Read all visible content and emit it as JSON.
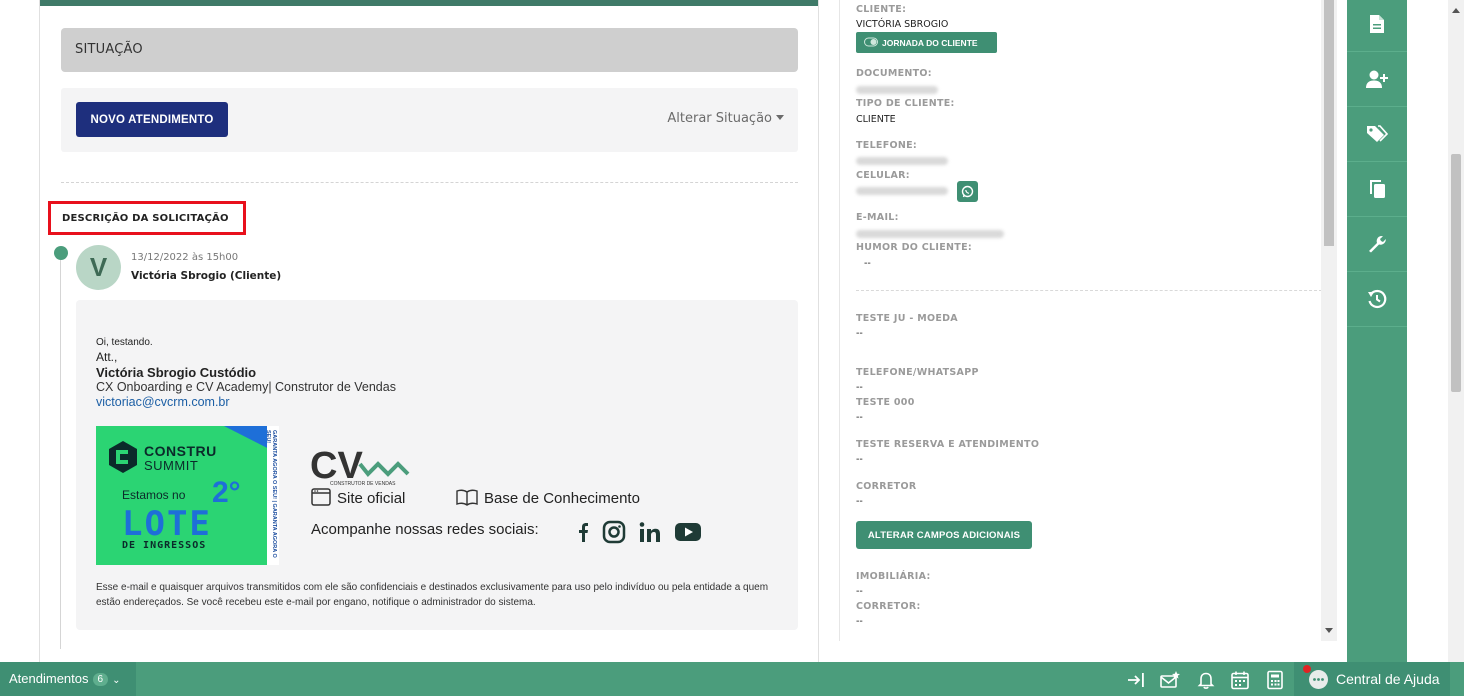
{
  "colors": {
    "accent": "#4b9d7c",
    "accent_dark": "#3f8f73",
    "primary_button": "#1e2f7d",
    "highlight_box": "#e8101c",
    "link": "#1c5fa5"
  },
  "main": {
    "situacao_label": "SITUAÇÃO",
    "novo_atendimento_label": "NOVO ATENDIMENTO",
    "alterar_situacao_label": "Alterar Situação",
    "descricao_label": "DESCRIÇÃO DA SOLICITAÇÃO",
    "message": {
      "avatar_letter": "V",
      "date": "13/12/2022 às 15h00",
      "author": "Victória Sbrogio (Cliente)"
    },
    "email": {
      "greeting": "Oi, testando.",
      "att": "Att.,",
      "sig_name": "Victória Sbrogio Custódio",
      "sig_role": "CX Onboarding e CV Academy| Construtor de Vendas",
      "sig_email": "victoriac@cvcrm.com.br",
      "banner": {
        "line1": "CONSTRU",
        "line2": "SUMMIT",
        "estamos": "Estamos no",
        "number": "2°",
        "lote": "LOTE",
        "ingressos": "DE INGRESSOS",
        "side": "GARANTA AGORA O SEU! | GARANTA AGORA O SEU!"
      },
      "cv_logo_text": "CV",
      "cv_sub": "CONSTRUTOR DE VENDAS",
      "site_label": "Site oficial",
      "base_label": "Base de Conhecimento",
      "social_label": "Acompanhe nossas redes sociais:",
      "social_icons": [
        "facebook-icon",
        "instagram-icon",
        "linkedin-icon",
        "youtube-icon"
      ],
      "disclaimer": "Esse e-mail e quaisquer arquivos transmitidos com ele são confidenciais e destinados exclusivamente para uso pelo indivíduo ou pela entidade a quem estão endereçados. Se você recebeu este e-mail por engano, notifique o administrador do sistema."
    }
  },
  "client": {
    "cliente_label": "CLIENTE:",
    "cliente_name": "VICTÓRIA SBROGIO",
    "jornada_label": "JORNADA DO CLIENTE",
    "documento_label": "DOCUMENTO:",
    "tipo_label": "TIPO DE CLIENTE:",
    "tipo_value": "CLIENTE",
    "telefone_label": "TELEFONE:",
    "celular_label": "CELULAR:",
    "email_label": "E-MAIL:",
    "humor_label": "HUMOR DO CLIENTE:",
    "humor_value": "--",
    "fields": [
      {
        "label": "TESTE JU - MOEDA",
        "value": "--"
      },
      {
        "label": "TELEFONE/WHATSAPP",
        "value": "--"
      },
      {
        "label": "TESTE 000",
        "value": "--"
      },
      {
        "label": "TESTE RESERVA E ATENDIMENTO",
        "value": "--"
      },
      {
        "label": "CORRETOR",
        "value": "--"
      }
    ],
    "alterar_campos_label": "ALTERAR CAMPOS ADICIONAIS",
    "imobiliaria_label": "IMOBILIÁRIA:",
    "imobiliaria_value": "--",
    "corretor2_label": "CORRETOR:",
    "corretor2_value": "--"
  },
  "toolbar": {
    "items": [
      "document-icon",
      "add-user-icon",
      "tags-icon",
      "copy-icon",
      "wrench-icon",
      "history-icon"
    ]
  },
  "bottom": {
    "atendimentos_label": "Atendimentos",
    "atendimentos_count": "6",
    "icons": [
      "login-arrow-icon",
      "mail-star-icon",
      "bell-icon",
      "calendar-icon",
      "calculator-icon"
    ],
    "ajuda_label": "Central de Ajuda"
  }
}
